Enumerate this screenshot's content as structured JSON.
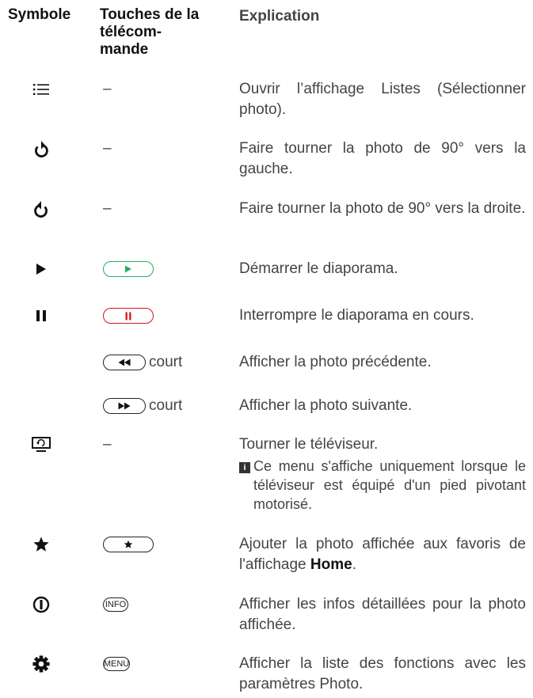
{
  "header": {
    "symbol": "Symbole",
    "keys": "Touches de la télécom-mande",
    "explanation": "Explication"
  },
  "rows": [
    {
      "icon": "list-icon",
      "key": "–",
      "text": "Ouvrir l’affichage Listes (Sélectionner photo)."
    },
    {
      "icon": "rotate-left-icon",
      "key": "–",
      "text": "Faire tourner la photo de 90° vers la gauche."
    },
    {
      "icon": "rotate-right-icon",
      "key": "–",
      "text": "Faire tourner la photo de 90° vers la droite."
    },
    {
      "icon": "play-icon",
      "key": "play-button",
      "text": "Démarrer le diaporama."
    },
    {
      "icon": "pause-icon",
      "key": "pause-button",
      "text": "Interrompre le diaporama en cours."
    },
    {
      "icon": "",
      "key": "rewind-button",
      "key_suffix": "court",
      "text": "Afficher la photo précédente."
    },
    {
      "icon": "",
      "key": "forward-button",
      "key_suffix": "court",
      "text": "Afficher la photo suivante."
    },
    {
      "icon": "tv-rotate-icon",
      "key": "–",
      "text": "Tourner le téléviseur.",
      "note": "Ce menu s'affiche uniquement lorsque le téléviseur est équipé d'un pied pivotant motorisé."
    },
    {
      "icon": "star-icon",
      "key": "star-button",
      "text_before": "Ajouter la photo affichée aux favoris de l'affichage ",
      "text_bold": "Home",
      "text_after": "."
    },
    {
      "icon": "info-icon",
      "key": "info-button",
      "key_label": "INFO",
      "text": "Afficher les infos détaillées pour la photo affichée."
    },
    {
      "icon": "gear-icon",
      "key": "menu-button",
      "key_label": "MENU",
      "text": "Afficher la liste des fonctions avec les paramètres Photo."
    }
  ],
  "colors": {
    "play_green": "#27ae60",
    "pause_red": "#d8121b"
  }
}
